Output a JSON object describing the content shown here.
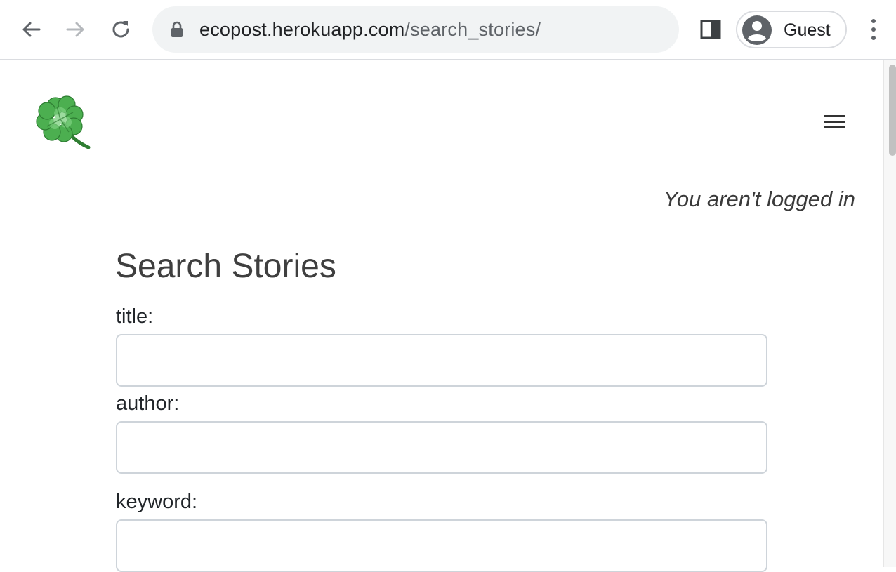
{
  "browser": {
    "url_domain": "ecopost.herokuapp.com",
    "url_path": "/search_stories/",
    "profile_name": "Guest"
  },
  "header": {
    "logo_icon": "four-leaf-clover-icon",
    "menu_icon": "hamburger-menu-icon"
  },
  "main": {
    "login_status": "You aren't logged in",
    "title": "Search Stories",
    "fields": {
      "title_label": "title:",
      "title_value": "",
      "author_label": "author:",
      "author_value": "",
      "keyword_label": "keyword:",
      "keyword_value": ""
    }
  },
  "colors": {
    "accent_green": "#3aa64a",
    "text_primary": "#212529",
    "heading": "#3f3f3f"
  }
}
